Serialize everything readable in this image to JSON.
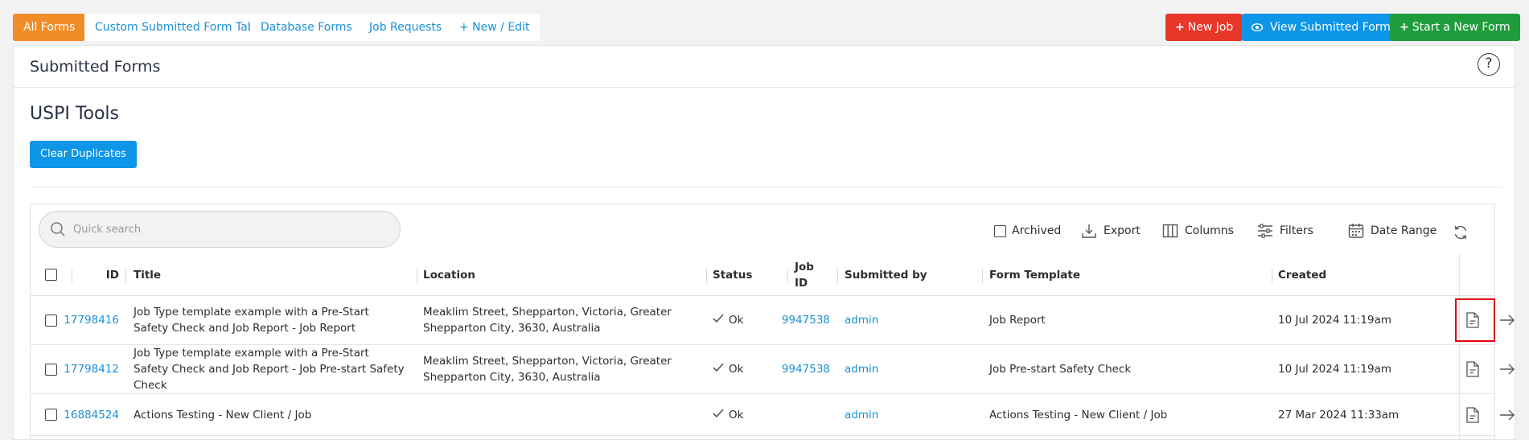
{
  "tabs": [
    {
      "label": "All Forms",
      "active": true
    },
    {
      "label": "Custom Submitted Form Tab",
      "active": false
    },
    {
      "label": "Database Forms",
      "active": false
    },
    {
      "label": "Job Requests",
      "active": false
    },
    {
      "label": "+ New / Edit",
      "active": false
    }
  ],
  "actions": {
    "new_job": "New Job",
    "view_submitted": "View Submitted Forms",
    "start_new_form": "Start a New Form"
  },
  "panel": {
    "title": "Submitted Forms",
    "help": "?",
    "tools_title": "USPI Tools",
    "clear_duplicates": "Clear Duplicates"
  },
  "grid": {
    "search_placeholder": "Quick search",
    "archived": "Archived",
    "export": "Export",
    "columns": "Columns",
    "filters": "Filters",
    "date_range": "Date Range",
    "headers": {
      "id": "ID",
      "title": "Title",
      "location": "Location",
      "status": "Status",
      "job_id": "Job ID",
      "submitted_by": "Submitted by",
      "form_template": "Form Template",
      "created": "Created"
    },
    "rows": [
      {
        "id": "17798416",
        "title": "Job Type template example with a Pre-Start Safety Check and Job Report - Job Report",
        "location": "Meaklim Street, Shepparton, Victoria, Greater Shepparton City, 3630, Australia",
        "status": "Ok",
        "job_id": "9947538",
        "submitted_by": "admin",
        "form_template": "Job Report",
        "created": "10 Jul 2024 11:19am"
      },
      {
        "id": "17798412",
        "title": "Job Type template example with a Pre-Start Safety Check and Job Report - Job Pre-start Safety Check",
        "location": "Meaklim Street, Shepparton, Victoria, Greater Shepparton City, 3630, Australia",
        "status": "Ok",
        "job_id": "9947538",
        "submitted_by": "admin",
        "form_template": "Job Pre-start Safety Check",
        "created": "10 Jul 2024 11:19am"
      },
      {
        "id": "16884524",
        "title": "Actions Testing - New Client / Job",
        "location": "",
        "status": "Ok",
        "job_id": "",
        "submitted_by": "admin",
        "form_template": "Actions Testing - New Client / Job",
        "created": "27 Mar 2024 11:33am"
      }
    ]
  },
  "colors": {
    "accent_orange": "#f28c28",
    "link_blue": "#1a8fd6",
    "btn_red": "#e8362b",
    "btn_blue": "#0d95e8",
    "btn_green": "#1f9d3c",
    "highlight_red": "#e3000f"
  },
  "icons": {
    "search": "search-icon",
    "export": "download-icon",
    "columns": "columns-icon",
    "filters": "sliders-icon",
    "date_range": "calendar-icon",
    "refresh": "refresh-icon",
    "status_ok": "check-icon",
    "row_pdf": "document-icon",
    "row_open": "arrow-right-icon"
  }
}
